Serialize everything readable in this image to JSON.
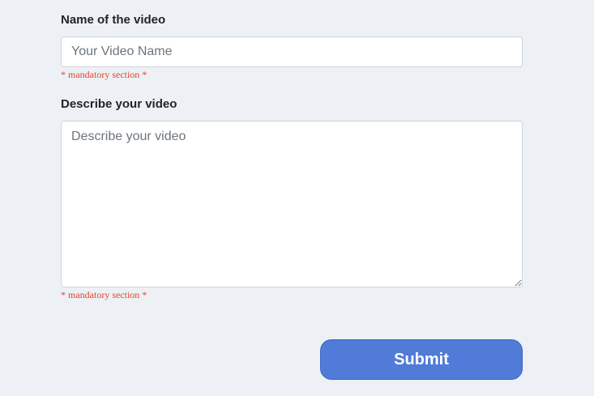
{
  "form": {
    "name_field": {
      "label": "Name of the video",
      "placeholder": "Your Video Name",
      "value": "",
      "hint": "* mandatory section *"
    },
    "description_field": {
      "label": "Describe your video",
      "placeholder": "Describe your video",
      "value": "",
      "hint": "* mandatory section *"
    },
    "submit_label": "Submit"
  },
  "colors": {
    "background": "#edf1f5",
    "hint": "#e8412b",
    "submit_button": "#507bd8"
  }
}
